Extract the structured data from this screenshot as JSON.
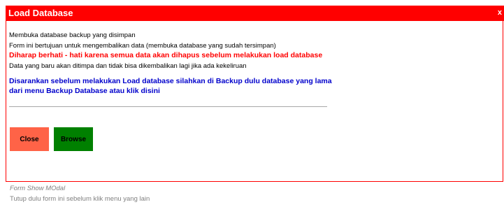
{
  "dialog": {
    "title": "Load Database",
    "close_symbol": "x",
    "lines": [
      "Membuka database backup yang disimpan",
      "Form ini bertujuan untuk mengembalikan data (membuka database yang sudah tersimpan)",
      "Diharap berhati - hati karena semua data akan dihapus sebelum melakukan load database",
      "Data yang baru akan ditimpa dan tidak bisa dikembalikan lagi jika ada kekeliruan",
      "Disarankan sebelum melakukan Load database silahkan di Backup dulu database yang lama",
      "dari menu Backup Database atau klik disini"
    ],
    "file_path": {
      "value": "",
      "placeholder": ""
    },
    "buttons": {
      "close_label": "Close",
      "browse_label": "Browse"
    }
  },
  "footer": {
    "mode": "Form Show MOdal",
    "note": "Tutup dulu form ini sebelum klik menu yang lain"
  },
  "colors": {
    "title_bar": "#ff0000",
    "warning_text": "#ff0000",
    "advice_text": "#0000cc",
    "close_button": "#ff6347",
    "browse_button": "#008000",
    "footer_text": "#808080"
  }
}
